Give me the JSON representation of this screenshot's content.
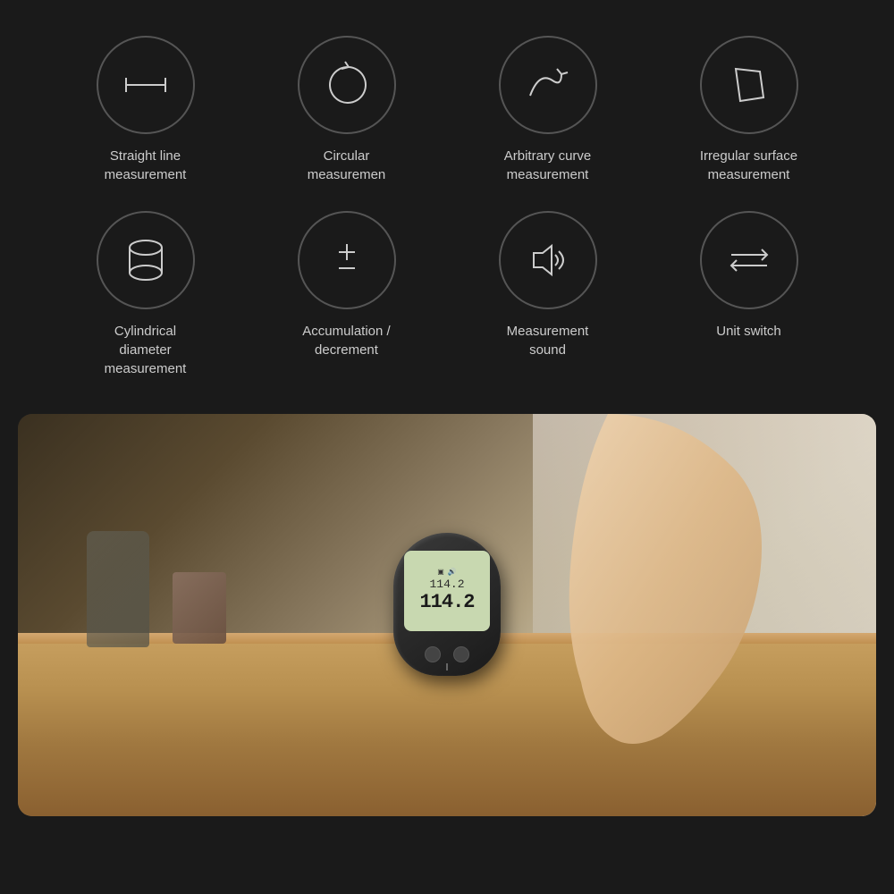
{
  "background": "#1a1a1a",
  "features_row1": [
    {
      "id": "straight-line",
      "label": "Straight line\nmeasurement",
      "icon": "ruler-line"
    },
    {
      "id": "circular",
      "label": "Circular\nmeasuremen",
      "icon": "circle-arrow"
    },
    {
      "id": "arbitrary-curve",
      "label": "Arbitrary curve\nmeasurement",
      "icon": "curve-arrow"
    },
    {
      "id": "irregular-surface",
      "label": "Irregular surface\nmeasurement",
      "icon": "irregular-shape"
    }
  ],
  "features_row2": [
    {
      "id": "cylindrical",
      "label": "Cylindrical\ndiameter\nmeasurement",
      "icon": "cylinder"
    },
    {
      "id": "accumulation",
      "label": "Accumulation /\ndecrement",
      "icon": "plus-minus"
    },
    {
      "id": "measurement-sound",
      "label": "Measurement\nsound",
      "icon": "speaker"
    },
    {
      "id": "unit-switch",
      "label": "Unit switch",
      "icon": "swap-arrows"
    }
  ],
  "device": {
    "display_value": "114.2",
    "display_sub": "114.2"
  }
}
